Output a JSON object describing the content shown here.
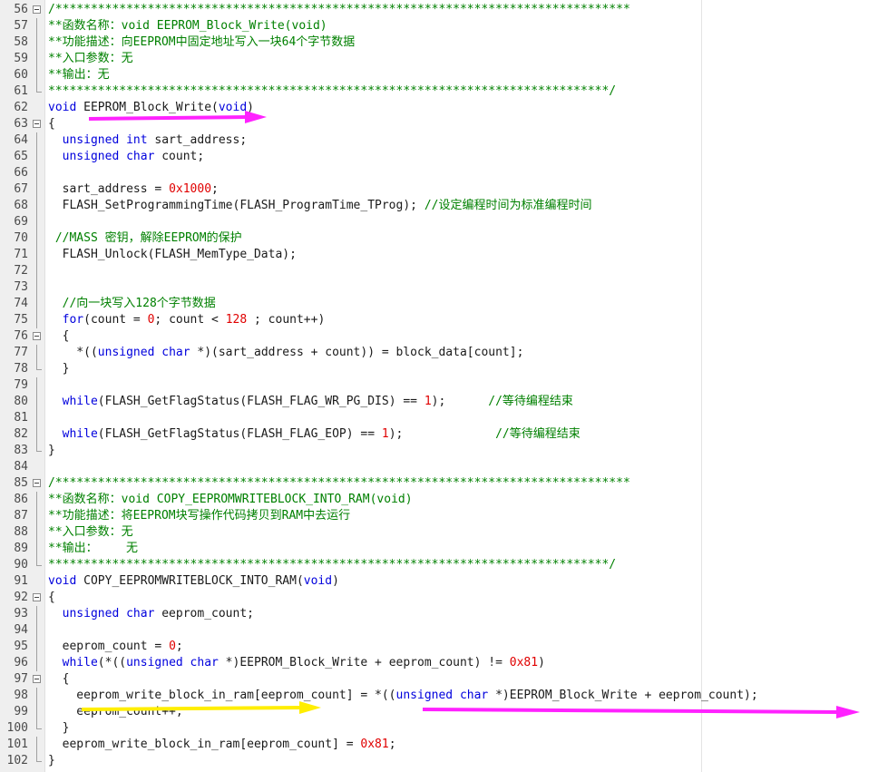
{
  "editor": {
    "lines": [
      {
        "n": "56",
        "fold": "box",
        "tokens": [
          [
            "cm",
            "/*********************************************************************************"
          ]
        ]
      },
      {
        "n": "57",
        "fold": "line",
        "tokens": [
          [
            "cm",
            "**函数名称：void EEPROM_Block_Write(void)"
          ]
        ]
      },
      {
        "n": "58",
        "fold": "line",
        "tokens": [
          [
            "cm",
            "**功能描述：向EEPROM中固定地址写入一块64个字节数据"
          ]
        ]
      },
      {
        "n": "59",
        "fold": "line",
        "tokens": [
          [
            "cm",
            "**入口参数：无"
          ]
        ]
      },
      {
        "n": "60",
        "fold": "line",
        "tokens": [
          [
            "cm",
            "**输出：无"
          ]
        ]
      },
      {
        "n": "61",
        "fold": "end",
        "tokens": [
          [
            "cm",
            "*******************************************************************************/"
          ]
        ]
      },
      {
        "n": "62",
        "fold": "",
        "tokens": [
          [
            "kw",
            "void"
          ],
          [
            "tx",
            " EEPROM_Block_Write("
          ],
          [
            "kw",
            "void"
          ],
          [
            "tx",
            ")"
          ]
        ]
      },
      {
        "n": "63",
        "fold": "box",
        "tokens": [
          [
            "tx",
            "{"
          ]
        ]
      },
      {
        "n": "64",
        "fold": "line",
        "tokens": [
          [
            "tx",
            "  "
          ],
          [
            "kw",
            "unsigned int"
          ],
          [
            "tx",
            " sart_address;"
          ]
        ]
      },
      {
        "n": "65",
        "fold": "line",
        "tokens": [
          [
            "tx",
            "  "
          ],
          [
            "kw",
            "unsigned char"
          ],
          [
            "tx",
            " count;"
          ]
        ]
      },
      {
        "n": "66",
        "fold": "line",
        "tokens": []
      },
      {
        "n": "67",
        "fold": "line",
        "tokens": [
          [
            "tx",
            "  sart_address = "
          ],
          [
            "nm",
            "0x1000"
          ],
          [
            "tx",
            ";"
          ]
        ]
      },
      {
        "n": "68",
        "fold": "line",
        "tokens": [
          [
            "tx",
            "  FLASH_SetProgrammingTime(FLASH_ProgramTime_TProg); "
          ],
          [
            "cm",
            "//设定编程时间为标准编程时间"
          ]
        ]
      },
      {
        "n": "69",
        "fold": "line",
        "tokens": []
      },
      {
        "n": "70",
        "fold": "line",
        "tokens": [
          [
            "tx",
            " "
          ],
          [
            "cm",
            "//MASS 密钥，解除EEPROM的保护"
          ]
        ]
      },
      {
        "n": "71",
        "fold": "line",
        "tokens": [
          [
            "tx",
            "  FLASH_Unlock(FLASH_MemType_Data);"
          ]
        ]
      },
      {
        "n": "72",
        "fold": "line",
        "tokens": []
      },
      {
        "n": "73",
        "fold": "line",
        "tokens": []
      },
      {
        "n": "74",
        "fold": "line",
        "tokens": [
          [
            "tx",
            "  "
          ],
          [
            "cm",
            "//向一块写入128个字节数据"
          ]
        ]
      },
      {
        "n": "75",
        "fold": "line",
        "tokens": [
          [
            "tx",
            "  "
          ],
          [
            "kw",
            "for"
          ],
          [
            "tx",
            "(count = "
          ],
          [
            "nm",
            "0"
          ],
          [
            "tx",
            "; count < "
          ],
          [
            "nm",
            "128"
          ],
          [
            "tx",
            " ; count++)"
          ]
        ]
      },
      {
        "n": "76",
        "fold": "box",
        "tokens": [
          [
            "tx",
            "  {"
          ]
        ]
      },
      {
        "n": "77",
        "fold": "line",
        "tokens": [
          [
            "tx",
            "    *(("
          ],
          [
            "kw",
            "unsigned char"
          ],
          [
            "tx",
            " *)(sart_address + count)) = block_data[count];"
          ]
        ]
      },
      {
        "n": "78",
        "fold": "end",
        "tokens": [
          [
            "tx",
            "  }"
          ]
        ]
      },
      {
        "n": "79",
        "fold": "line",
        "tokens": []
      },
      {
        "n": "80",
        "fold": "line",
        "tokens": [
          [
            "tx",
            "  "
          ],
          [
            "kw",
            "while"
          ],
          [
            "tx",
            "(FLASH_GetFlagStatus(FLASH_FLAG_WR_PG_DIS) == "
          ],
          [
            "nm",
            "1"
          ],
          [
            "tx",
            ");      "
          ],
          [
            "cm",
            "//等待编程结束"
          ]
        ]
      },
      {
        "n": "81",
        "fold": "line",
        "tokens": []
      },
      {
        "n": "82",
        "fold": "line",
        "tokens": [
          [
            "tx",
            "  "
          ],
          [
            "kw",
            "while"
          ],
          [
            "tx",
            "(FLASH_GetFlagStatus(FLASH_FLAG_EOP) == "
          ],
          [
            "nm",
            "1"
          ],
          [
            "tx",
            ");             "
          ],
          [
            "cm",
            "//等待编程结束"
          ]
        ]
      },
      {
        "n": "83",
        "fold": "end",
        "tokens": [
          [
            "tx",
            "}"
          ]
        ]
      },
      {
        "n": "84",
        "fold": "",
        "tokens": []
      },
      {
        "n": "85",
        "fold": "box",
        "tokens": [
          [
            "cm",
            "/*********************************************************************************"
          ]
        ]
      },
      {
        "n": "86",
        "fold": "line",
        "tokens": [
          [
            "cm",
            "**函数名称：void COPY_EEPROMWRITEBLOCK_INTO_RAM(void)"
          ]
        ]
      },
      {
        "n": "87",
        "fold": "line",
        "tokens": [
          [
            "cm",
            "**功能描述：将EEPROM块写操作代码拷贝到RAM中去运行"
          ]
        ]
      },
      {
        "n": "88",
        "fold": "line",
        "tokens": [
          [
            "cm",
            "**入口参数：无"
          ]
        ]
      },
      {
        "n": "89",
        "fold": "line",
        "tokens": [
          [
            "cm",
            "**输出：    无"
          ]
        ]
      },
      {
        "n": "90",
        "fold": "end",
        "tokens": [
          [
            "cm",
            "*******************************************************************************/"
          ]
        ]
      },
      {
        "n": "91",
        "fold": "",
        "tokens": [
          [
            "kw",
            "void"
          ],
          [
            "tx",
            " COPY_EEPROMWRITEBLOCK_INTO_RAM("
          ],
          [
            "kw",
            "void"
          ],
          [
            "tx",
            ")"
          ]
        ]
      },
      {
        "n": "92",
        "fold": "box",
        "tokens": [
          [
            "tx",
            "{"
          ]
        ]
      },
      {
        "n": "93",
        "fold": "line",
        "tokens": [
          [
            "tx",
            "  "
          ],
          [
            "kw",
            "unsigned char"
          ],
          [
            "tx",
            " eeprom_count;"
          ]
        ]
      },
      {
        "n": "94",
        "fold": "line",
        "tokens": []
      },
      {
        "n": "95",
        "fold": "line",
        "tokens": [
          [
            "tx",
            "  eeprom_count = "
          ],
          [
            "nm",
            "0"
          ],
          [
            "tx",
            ";"
          ]
        ]
      },
      {
        "n": "96",
        "fold": "line",
        "tokens": [
          [
            "tx",
            "  "
          ],
          [
            "kw",
            "while"
          ],
          [
            "tx",
            "(*(("
          ],
          [
            "kw",
            "unsigned char"
          ],
          [
            "tx",
            " *)EEPROM_Block_Write + eeprom_count) != "
          ],
          [
            "nm",
            "0x81"
          ],
          [
            "tx",
            ")"
          ]
        ]
      },
      {
        "n": "97",
        "fold": "box",
        "tokens": [
          [
            "tx",
            "  {"
          ]
        ]
      },
      {
        "n": "98",
        "fold": "line",
        "tokens": [
          [
            "tx",
            "    eeprom_write_block_in_ram[eeprom_count] = *(("
          ],
          [
            "kw",
            "unsigned char"
          ],
          [
            "tx",
            " *)EEPROM_Block_Write + eeprom_count);"
          ]
        ]
      },
      {
        "n": "99",
        "fold": "line",
        "tokens": [
          [
            "tx",
            "    eeprom_count++;"
          ]
        ]
      },
      {
        "n": "100",
        "fold": "end",
        "tokens": [
          [
            "tx",
            "  }"
          ]
        ]
      },
      {
        "n": "101",
        "fold": "line",
        "tokens": [
          [
            "tx",
            "  eeprom_write_block_in_ram[eeprom_count] = "
          ],
          [
            "nm",
            "0x81"
          ],
          [
            "tx",
            ";"
          ]
        ]
      },
      {
        "n": "102",
        "fold": "end",
        "tokens": [
          [
            "tx",
            "}"
          ]
        ]
      }
    ]
  },
  "annotations": {
    "arrow_colors": {
      "magenta": "#ff22ff",
      "yellow": "#ffee00"
    }
  }
}
